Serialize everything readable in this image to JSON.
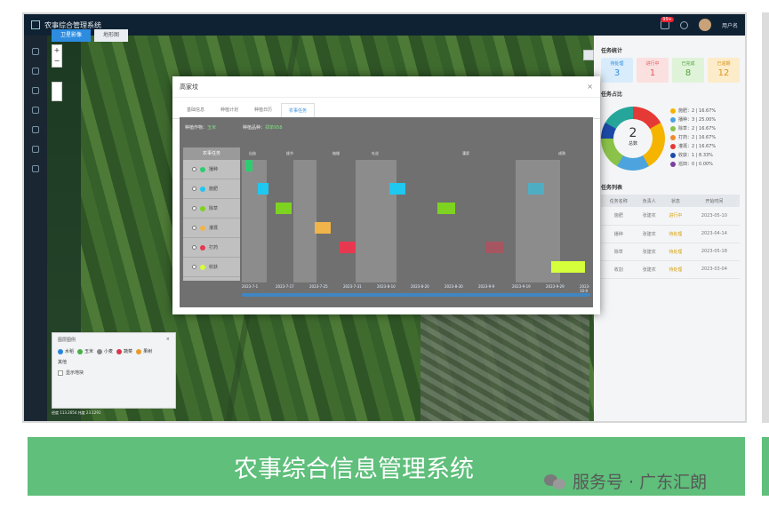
{
  "app": {
    "title": "农事综合管理系统",
    "bell_badge": "99+",
    "user": "用户名"
  },
  "map_tabs": [
    "卫星影像",
    "地形图"
  ],
  "map_tools": {
    "zoom_in": "+",
    "zoom_out": "−"
  },
  "legend_box": {
    "title": "图层图例",
    "close": "×",
    "items": [
      {
        "label": "水稻",
        "color": "#2a86d6"
      },
      {
        "label": "玉米",
        "color": "#45b044"
      },
      {
        "label": "小麦",
        "color": "#888888"
      },
      {
        "label": "蔬菜",
        "color": "#d6364a"
      },
      {
        "label": "果树",
        "color": "#e89a2a"
      }
    ],
    "section": "其他",
    "check_label": "显示地块"
  },
  "coords": "经度 113.2654  纬度 23.1291",
  "right_panel": {
    "stats_title": "任务统计",
    "stats": [
      {
        "label": "待处理",
        "value": "3",
        "bg": "#d9ecfb",
        "fg": "#2d8ce0"
      },
      {
        "label": "进行中",
        "value": "1",
        "bg": "#fbe0e0",
        "fg": "#e05a5a"
      },
      {
        "label": "已完成",
        "value": "8",
        "bg": "#dff3d9",
        "fg": "#53a33a"
      },
      {
        "label": "已逾期",
        "value": "12",
        "bg": "#fdecc9",
        "fg": "#d7941a"
      }
    ],
    "donut_title": "任务占比",
    "donut_value": "2",
    "donut_label": "总数",
    "donut_legend": [
      {
        "label": "施肥：2 | 16.67%",
        "color": "#f5b400"
      },
      {
        "label": "播种：3 | 25.00%",
        "color": "#4ca3dd"
      },
      {
        "label": "除草：2 | 16.67%",
        "color": "#8bc34a"
      },
      {
        "label": "打药：2 | 16.67%",
        "color": "#ef8a2b"
      },
      {
        "label": "灌溉：2 | 16.67%",
        "color": "#e53935"
      },
      {
        "label": "收获：1 | 8.33%",
        "color": "#1d4aa8"
      },
      {
        "label": "巡田：0 | 0.00%",
        "color": "#7b3fa0"
      }
    ],
    "table_title": "任务列表",
    "table_headers": [
      "任务名称",
      "负责人",
      "状态",
      "开始时间"
    ],
    "table_rows": [
      [
        "施肥",
        "张建农",
        "进行中",
        "2023-05-10"
      ],
      [
        "播种",
        "张建农",
        "待处理",
        "2023-04-14"
      ],
      [
        "除草",
        "张建农",
        "待处理",
        "2023-05-18"
      ],
      [
        "收割",
        "张建农",
        "待处理",
        "2023-03-04"
      ]
    ]
  },
  "modal": {
    "title": "高家坟",
    "close": "×",
    "tabs": [
      "基础信息",
      "种植计划",
      "种植日历",
      "农事任务"
    ],
    "active_tab": 3,
    "info": [
      {
        "label": "种植作物：",
        "value": "玉米"
      },
      {
        "label": "种植品种：",
        "value": "郑单958"
      }
    ]
  },
  "gantt": {
    "left_header": "农事任务",
    "tasks": [
      {
        "label": "播种",
        "color": "#2ecc71"
      },
      {
        "label": "施肥",
        "color": "#1ec8f0"
      },
      {
        "label": "除草",
        "color": "#7ed321"
      },
      {
        "label": "灌溉",
        "color": "#f0b44a"
      },
      {
        "label": "打药",
        "color": "#e8384f"
      },
      {
        "label": "收获",
        "color": "#d4ff3a"
      }
    ],
    "phases": [
      "出苗",
      "拔节",
      "抽雄",
      "吐丝",
      "灌浆",
      "成熟"
    ],
    "dates": [
      "2023-7-1",
      "2023-7-17",
      "2023-7-25",
      "2023-7-31",
      "2023-8-10",
      "2023-8-20",
      "2023-8-30",
      "2023-9-9",
      "2023-9-19",
      "2023-9-29",
      "2023-10-9"
    ]
  },
  "banner": {
    "title": "农事综合信息管理系统"
  },
  "watermark": {
    "text": "服务号 · 广东汇朗"
  }
}
